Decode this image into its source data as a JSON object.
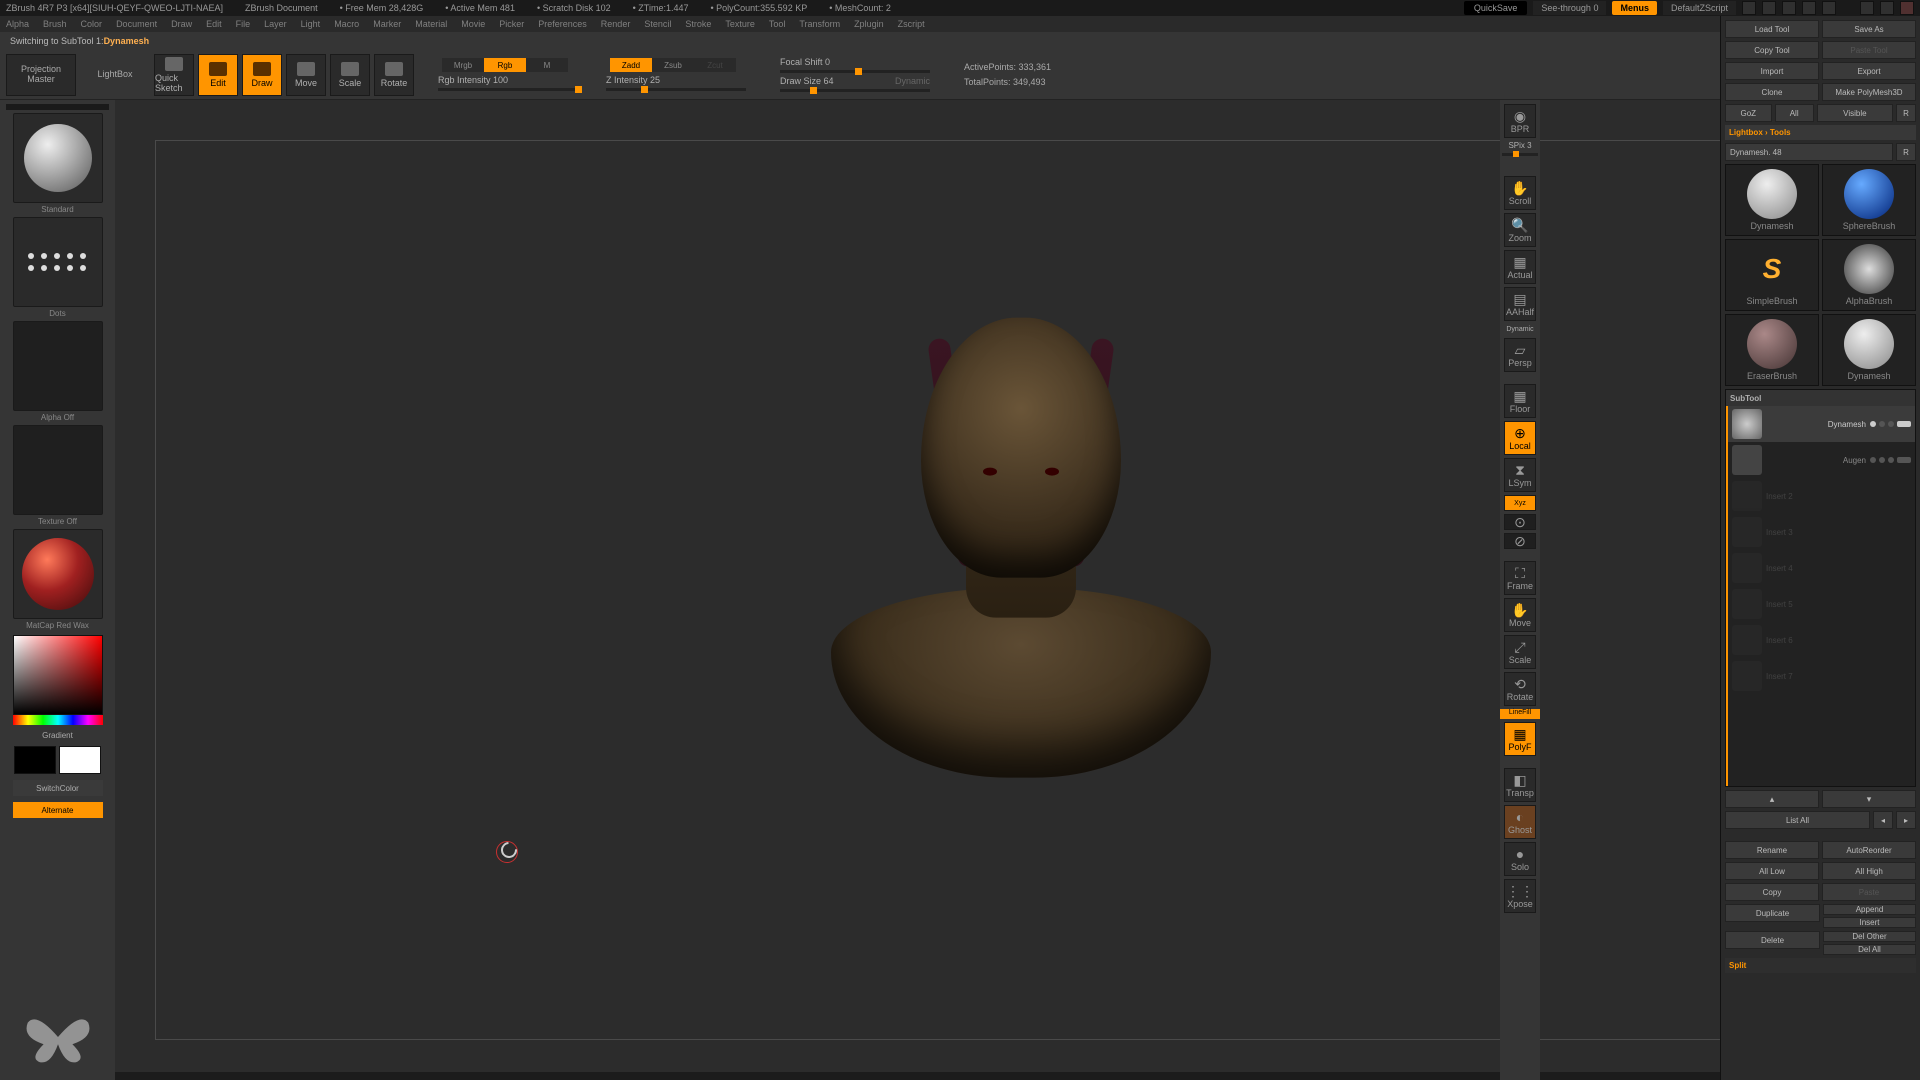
{
  "titlebar": {
    "app": "ZBrush 4R7 P3 [x64][SIUH-QEYF-QWEO-LJTI-NAEA]",
    "doctitle": "ZBrush Document",
    "freemem": "• Free Mem 28,428G",
    "activemem": "• Active Mem 481",
    "scratchdisk": "• Scratch Disk 102",
    "ztime": "• ZTime:1.447",
    "polycount": "• PolyCount:355.592 KP",
    "meshcount": "• MeshCount: 2",
    "quicksave": "QuickSave",
    "seethru": "See-through  0",
    "menus": "Menus",
    "script": "DefaultZScript"
  },
  "menubar": [
    "Alpha",
    "Brush",
    "Color",
    "Document",
    "Draw",
    "Edit",
    "File",
    "Layer",
    "Light",
    "Macro",
    "Marker",
    "Material",
    "Movie",
    "Picker",
    "Preferences",
    "Render",
    "Stencil",
    "Stroke",
    "Texture",
    "Tool",
    "Transform",
    "Zplugin",
    "Zscript"
  ],
  "status": {
    "prefix": "Switching to SubTool 1:  ",
    "name": "Dynamesh"
  },
  "shelf": {
    "projection": "Projection Master",
    "lightbox": "LightBox",
    "quicksketch": "Quick Sketch",
    "edit": "Edit",
    "draw": "Draw",
    "move": "Move",
    "scale": "Scale",
    "rotate": "Rotate",
    "mrgb": "Mrgb",
    "rgb": "Rgb",
    "m": "M",
    "rgb_int": "Rgb Intensity 100",
    "zadd": "Zadd",
    "zsub": "Zsub",
    "zcut": "Zcut",
    "z_int": "Z Intensity 25",
    "focal": "Focal Shift 0",
    "drawsize": "Draw Size 64",
    "dynamic": "Dynamic",
    "active": "ActivePoints: 333,361",
    "total": "TotalPoints: 349,493"
  },
  "left": {
    "brush": "Standard",
    "stroke": "Dots",
    "alpha": "Alpha  Off",
    "texture": "Texture  Off",
    "material": "MatCap Red Wax",
    "gradient": "Gradient",
    "switch": "SwitchColor",
    "alternate": "Alternate"
  },
  "sidenav": {
    "bpr": "BPR",
    "spix": "SPix 3",
    "scroll": "Scroll",
    "zoom": "Zoom",
    "actual": "Actual",
    "aahalf": "AAHalf",
    "persp": "Persp",
    "floor": "Floor",
    "local": "Local",
    "lsym": "LSym",
    "xyz": "Xyz",
    "pivot1": "·",
    "pivot2": "·",
    "frame": "Frame",
    "move": "Move",
    "scale": "Scale",
    "rotate": "Rotate",
    "linefill": "LineFill",
    "polyf": "PolyF",
    "transp": "Transp",
    "ghost": "Ghost",
    "solo": "Solo",
    "xpose": "Xpose",
    "dynamic": "Dynamic"
  },
  "right": {
    "load": "Load Tool",
    "save": "Save As",
    "copytool": "Copy Tool",
    "pastetool": "Paste Tool",
    "import": "Import",
    "export": "Export",
    "clone": "Clone",
    "makepoly": "Make PolyMesh3D",
    "goz": "GoZ",
    "all": "All",
    "visible": "Visible",
    "r": "R",
    "lbtools": "Lightbox › Tools",
    "dyn48": "Dynamesh. 48",
    "r2": "R",
    "tools": [
      {
        "name": "Dynamesh",
        "kind": "bust"
      },
      {
        "name": "SphereBrush",
        "kind": "sphere"
      },
      {
        "name": "SimpleBrush",
        "kind": "s"
      },
      {
        "name": "AlphaBrush",
        "kind": "alpha"
      },
      {
        "name": "EraserBrush",
        "kind": "erase"
      },
      {
        "name": "Dynamesh",
        "kind": "bust2"
      }
    ],
    "subtool_hdr": "SubTool",
    "subtools": [
      {
        "name": "Dynamesh",
        "sel": true
      },
      {
        "name": "Augen",
        "sel": false
      },
      {
        "name": "Insert 2",
        "sel": false,
        "dim": true
      },
      {
        "name": "Insert 3",
        "sel": false,
        "dim": true
      },
      {
        "name": "Insert 4",
        "sel": false,
        "dim": true
      },
      {
        "name": "Insert 5",
        "sel": false,
        "dim": true
      },
      {
        "name": "Insert 6",
        "sel": false,
        "dim": true
      },
      {
        "name": "Insert 7",
        "sel": false,
        "dim": true
      }
    ],
    "listall": "List All",
    "rename": "Rename",
    "autoreorder": "AutoReorder",
    "alllow": "All Low",
    "allhigh": "All High",
    "copy": "Copy",
    "paste": "Paste",
    "duplicate": "Duplicate",
    "append": "Append",
    "insert": "Insert",
    "delete": "Delete",
    "delother": "Del Other",
    "delall": "Del All",
    "split": "Split"
  }
}
